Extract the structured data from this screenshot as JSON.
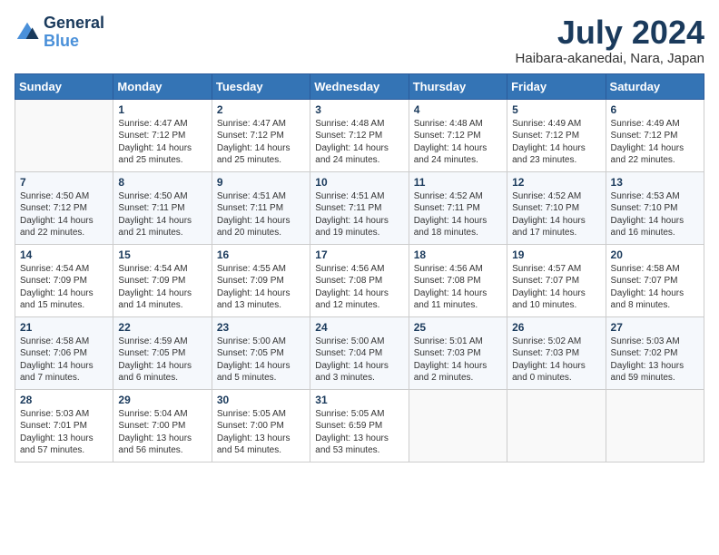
{
  "header": {
    "logo_line1": "General",
    "logo_line2": "Blue",
    "month_year": "July 2024",
    "location": "Haibara-akanedai, Nara, Japan"
  },
  "weekdays": [
    "Sunday",
    "Monday",
    "Tuesday",
    "Wednesday",
    "Thursday",
    "Friday",
    "Saturday"
  ],
  "weeks": [
    [
      {
        "day": "",
        "info": ""
      },
      {
        "day": "1",
        "info": "Sunrise: 4:47 AM\nSunset: 7:12 PM\nDaylight: 14 hours\nand 25 minutes."
      },
      {
        "day": "2",
        "info": "Sunrise: 4:47 AM\nSunset: 7:12 PM\nDaylight: 14 hours\nand 25 minutes."
      },
      {
        "day": "3",
        "info": "Sunrise: 4:48 AM\nSunset: 7:12 PM\nDaylight: 14 hours\nand 24 minutes."
      },
      {
        "day": "4",
        "info": "Sunrise: 4:48 AM\nSunset: 7:12 PM\nDaylight: 14 hours\nand 24 minutes."
      },
      {
        "day": "5",
        "info": "Sunrise: 4:49 AM\nSunset: 7:12 PM\nDaylight: 14 hours\nand 23 minutes."
      },
      {
        "day": "6",
        "info": "Sunrise: 4:49 AM\nSunset: 7:12 PM\nDaylight: 14 hours\nand 22 minutes."
      }
    ],
    [
      {
        "day": "7",
        "info": ""
      },
      {
        "day": "8",
        "info": "Sunrise: 4:50 AM\nSunset: 7:11 PM\nDaylight: 14 hours\nand 21 minutes."
      },
      {
        "day": "9",
        "info": "Sunrise: 4:51 AM\nSunset: 7:11 PM\nDaylight: 14 hours\nand 20 minutes."
      },
      {
        "day": "10",
        "info": "Sunrise: 4:51 AM\nSunset: 7:11 PM\nDaylight: 14 hours\nand 19 minutes."
      },
      {
        "day": "11",
        "info": "Sunrise: 4:52 AM\nSunset: 7:11 PM\nDaylight: 14 hours\nand 18 minutes."
      },
      {
        "day": "12",
        "info": "Sunrise: 4:52 AM\nSunset: 7:10 PM\nDaylight: 14 hours\nand 17 minutes."
      },
      {
        "day": "13",
        "info": "Sunrise: 4:53 AM\nSunset: 7:10 PM\nDaylight: 14 hours\nand 16 minutes."
      }
    ],
    [
      {
        "day": "14",
        "info": ""
      },
      {
        "day": "15",
        "info": "Sunrise: 4:54 AM\nSunset: 7:09 PM\nDaylight: 14 hours\nand 14 minutes."
      },
      {
        "day": "16",
        "info": "Sunrise: 4:55 AM\nSunset: 7:09 PM\nDaylight: 14 hours\nand 13 minutes."
      },
      {
        "day": "17",
        "info": "Sunrise: 4:56 AM\nSunset: 7:08 PM\nDaylight: 14 hours\nand 12 minutes."
      },
      {
        "day": "18",
        "info": "Sunrise: 4:56 AM\nSunset: 7:08 PM\nDaylight: 14 hours\nand 11 minutes."
      },
      {
        "day": "19",
        "info": "Sunrise: 4:57 AM\nSunset: 7:07 PM\nDaylight: 14 hours\nand 10 minutes."
      },
      {
        "day": "20",
        "info": "Sunrise: 4:58 AM\nSunset: 7:07 PM\nDaylight: 14 hours\nand 8 minutes."
      }
    ],
    [
      {
        "day": "21",
        "info": ""
      },
      {
        "day": "22",
        "info": "Sunrise: 4:59 AM\nSunset: 7:05 PM\nDaylight: 14 hours\nand 6 minutes."
      },
      {
        "day": "23",
        "info": "Sunrise: 5:00 AM\nSunset: 7:05 PM\nDaylight: 14 hours\nand 5 minutes."
      },
      {
        "day": "24",
        "info": "Sunrise: 5:00 AM\nSunset: 7:04 PM\nDaylight: 14 hours\nand 3 minutes."
      },
      {
        "day": "25",
        "info": "Sunrise: 5:01 AM\nSunset: 7:03 PM\nDaylight: 14 hours\nand 2 minutes."
      },
      {
        "day": "26",
        "info": "Sunrise: 5:02 AM\nSunset: 7:03 PM\nDaylight: 14 hours\nand 0 minutes."
      },
      {
        "day": "27",
        "info": "Sunrise: 5:03 AM\nSunset: 7:02 PM\nDaylight: 13 hours\nand 59 minutes."
      }
    ],
    [
      {
        "day": "28",
        "info": ""
      },
      {
        "day": "29",
        "info": "Sunrise: 5:04 AM\nSunset: 7:00 PM\nDaylight: 13 hours\nand 56 minutes."
      },
      {
        "day": "30",
        "info": "Sunrise: 5:05 AM\nSunset: 7:00 PM\nDaylight: 13 hours\nand 54 minutes."
      },
      {
        "day": "31",
        "info": "Sunrise: 5:05 AM\nSunset: 6:59 PM\nDaylight: 13 hours\nand 53 minutes."
      },
      {
        "day": "",
        "info": ""
      },
      {
        "day": "",
        "info": ""
      },
      {
        "day": "",
        "info": ""
      }
    ]
  ],
  "week0_day7_info": "Sunrise: 4:50 AM\nSunset: 7:12 PM\nDaylight: 14 hours\nand 22 minutes.",
  "week1_day0_info": "Sunrise: 4:50 AM\nSunset: 7:12 PM\nDaylight: 14 hours\nand 22 minutes.",
  "week2_day0_info": "Sunrise: 4:54 AM\nSunset: 7:09 PM\nDaylight: 14 hours\nand 15 minutes.",
  "week3_day0_info": "Sunrise: 4:58 AM\nSunset: 7:06 PM\nDaylight: 14 hours\nand 7 minutes.",
  "week4_day0_info": "Sunrise: 5:03 AM\nSunset: 7:01 PM\nDaylight: 13 hours\nand 57 minutes."
}
